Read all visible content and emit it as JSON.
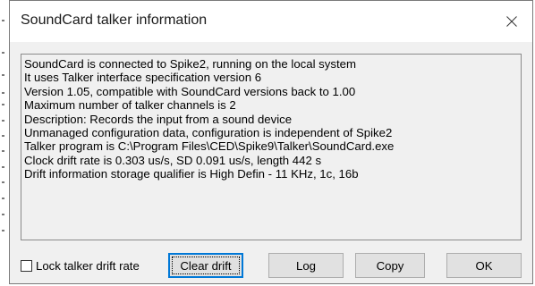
{
  "window": {
    "title": "SoundCard talker information",
    "close_icon": "close-icon"
  },
  "info": {
    "lines": [
      "SoundCard is connected to Spike2, running on the local system",
      "It uses Talker interface specification version 6",
      "Version 1.05, compatible with SoundCard versions back to 1.00",
      "Maximum number of talker channels is 2",
      "Description: Records the input from a sound device",
      "Unmanaged configuration data, configuration is independent of Spike2",
      "Talker program is C:\\Program Files\\CED\\Spike9\\Talker\\SoundCard.exe",
      "Clock drift rate is 0.303 us/s, SD 0.091 us/s, length 442 s",
      "Drift information storage qualifier is High Defin - 11 KHz, 1c, 16b"
    ]
  },
  "controls": {
    "lock_drift_label": "Lock talker drift rate",
    "lock_drift_checked": false,
    "clear_drift_label": "Clear drift",
    "log_label": "Log",
    "copy_label": "Copy",
    "ok_label": "OK"
  },
  "colors": {
    "dialog_bg": "#f0f0f0",
    "titlebar_bg": "#ffffff",
    "focus_border": "#0078d7"
  }
}
